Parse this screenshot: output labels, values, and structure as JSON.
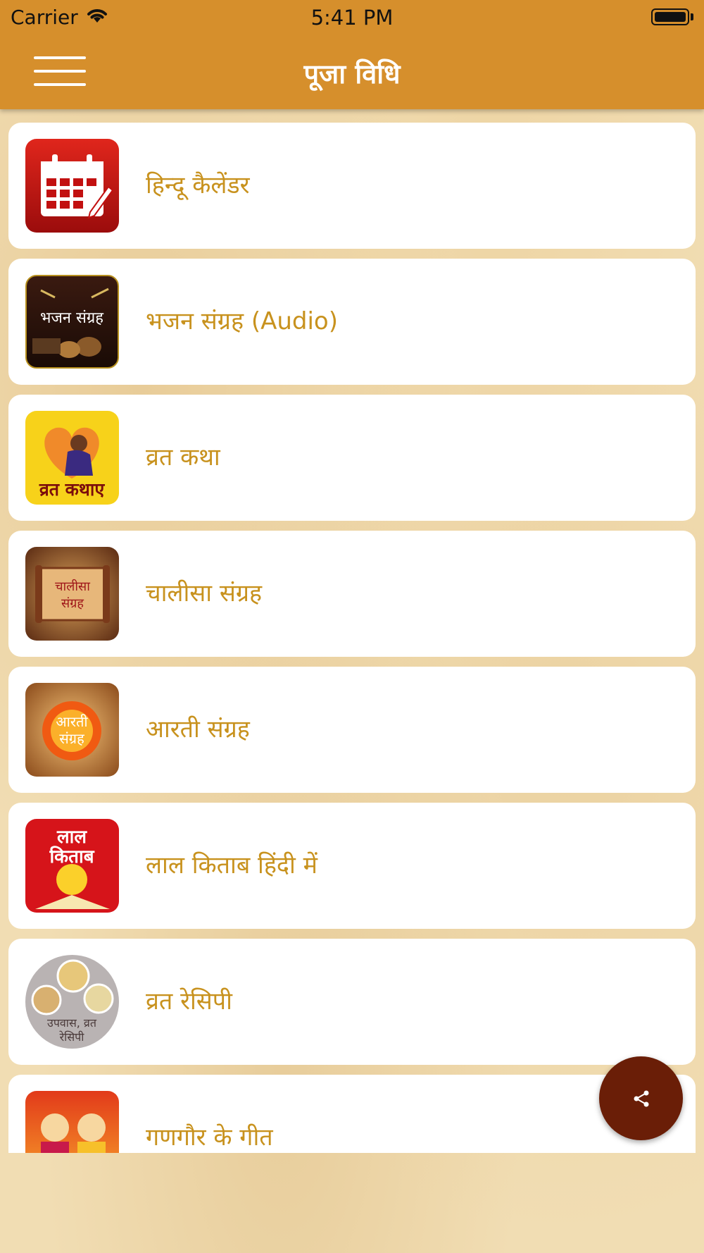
{
  "status_bar": {
    "carrier": "Carrier",
    "time": "5:41 PM"
  },
  "header": {
    "title": "पूजा विधि"
  },
  "items": [
    {
      "label": "हिन्दू कैलेंडर",
      "icon": "calendar-icon"
    },
    {
      "label": "भजन संग्रह (Audio)",
      "icon": "bhajan-sangrah-icon",
      "thumb_text": "भजन संग्रह"
    },
    {
      "label": "व्रत कथा",
      "icon": "vrat-katha-icon",
      "thumb_text": "व्रत कथाए"
    },
    {
      "label": "चालीसा संग्रह",
      "icon": "chalisa-sangrah-icon",
      "thumb_text_1": "चालीसा",
      "thumb_text_2": "संग्रह"
    },
    {
      "label": "आरती संग्रह",
      "icon": "aarti-sangrah-icon",
      "thumb_text_1": "आरती",
      "thumb_text_2": "संग्रह"
    },
    {
      "label": "लाल किताब हिंदी में",
      "icon": "lal-kitab-icon",
      "thumb_text_1": "लाल",
      "thumb_text_2": "किताब"
    },
    {
      "label": "व्रत रेसिपी",
      "icon": "vrat-recipe-icon",
      "thumb_text_1": "उपवास, व्रत",
      "thumb_text_2": "रेसिपी"
    },
    {
      "label": "गणगौर के गीत",
      "icon": "gangaur-geet-icon"
    }
  ],
  "colors": {
    "header": "#d68f2c",
    "label": "#c8921e",
    "fab": "#6a1e07"
  }
}
